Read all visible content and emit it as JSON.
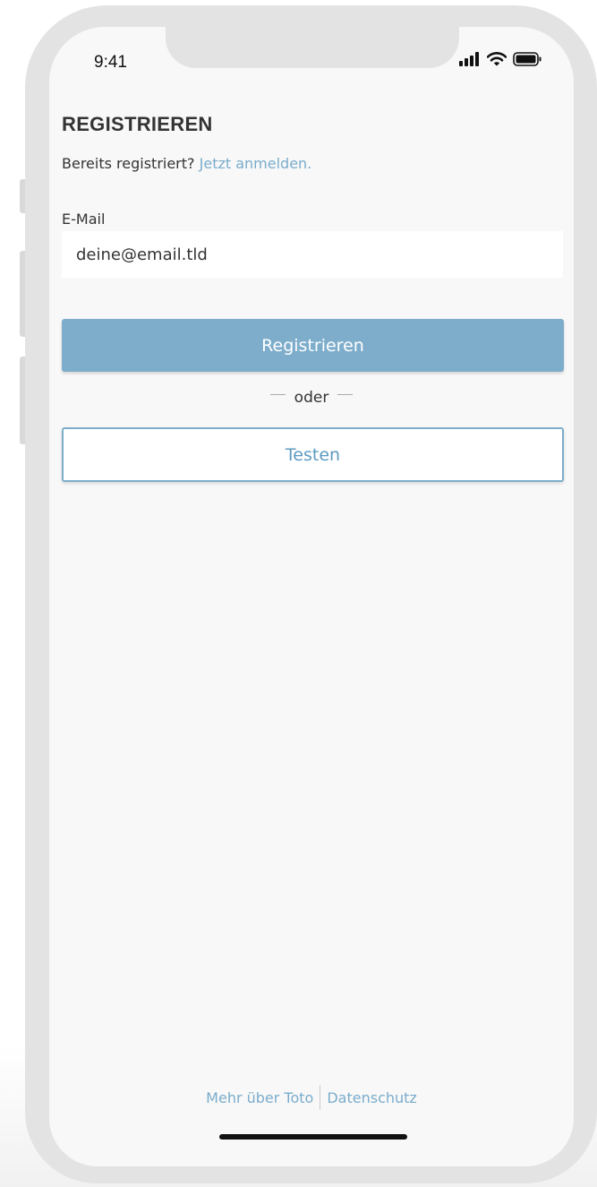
{
  "status_bar": {
    "time": "9:41"
  },
  "page": {
    "title": "REGISTRIEREN",
    "subtitle_text": "Bereits registriert?",
    "login_link": "Jetzt anmelden."
  },
  "form": {
    "email_label": "E-Mail",
    "email_placeholder": "deine@email.tld",
    "register_button": "Registrieren",
    "divider_text": "oder",
    "test_button": "Testen"
  },
  "footer": {
    "about_link": "Mehr über Toto",
    "privacy_link": "Datenschutz"
  },
  "colors": {
    "accent": "#7dadcb",
    "link": "#7aaccc",
    "background": "#f8f8f8"
  },
  "icons": [
    "cellular-signal-icon",
    "wifi-icon",
    "battery-icon"
  ]
}
